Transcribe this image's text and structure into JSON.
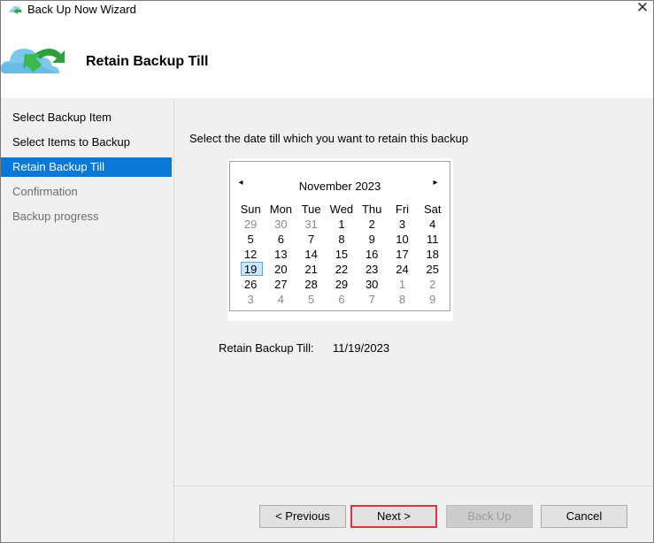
{
  "window": {
    "title": "Back Up Now Wizard",
    "close_glyph": "✕"
  },
  "header": {
    "title": "Retain Backup Till",
    "icon": "cloud-backup-icon"
  },
  "sidebar": {
    "items": [
      {
        "label": "Select Backup Item",
        "state": "normal"
      },
      {
        "label": "Select Items to Backup",
        "state": "normal"
      },
      {
        "label": "Retain Backup Till",
        "state": "active"
      },
      {
        "label": "Confirmation",
        "state": "disabled"
      },
      {
        "label": "Backup progress",
        "state": "disabled"
      }
    ],
    "active_color": "#0a78d7"
  },
  "main": {
    "instruction": "Select the date till which you want to retain this backup",
    "calendar": {
      "month": "November 2023",
      "prev_glyph": "◂",
      "next_glyph": "▸",
      "weekdays": [
        "Sun",
        "Mon",
        "Tue",
        "Wed",
        "Thu",
        "Fri",
        "Sat"
      ],
      "weeks": [
        [
          "29",
          "30",
          "31",
          "1",
          "2",
          "3",
          "4"
        ],
        [
          "5",
          "6",
          "7",
          "8",
          "9",
          "10",
          "11"
        ],
        [
          "12",
          "13",
          "14",
          "15",
          "16",
          "17",
          "18"
        ],
        [
          "19",
          "20",
          "21",
          "22",
          "23",
          "24",
          "25"
        ],
        [
          "26",
          "27",
          "28",
          "29",
          "30",
          "1",
          "2"
        ],
        [
          "3",
          "4",
          "5",
          "6",
          "7",
          "8",
          "9"
        ]
      ],
      "selected_day": "19"
    },
    "retain_label": "Retain Backup Till:",
    "retain_value": "11/19/2023"
  },
  "footer": {
    "previous": "< Previous",
    "next": "Next >",
    "backup": "Back Up",
    "cancel": "Cancel"
  }
}
